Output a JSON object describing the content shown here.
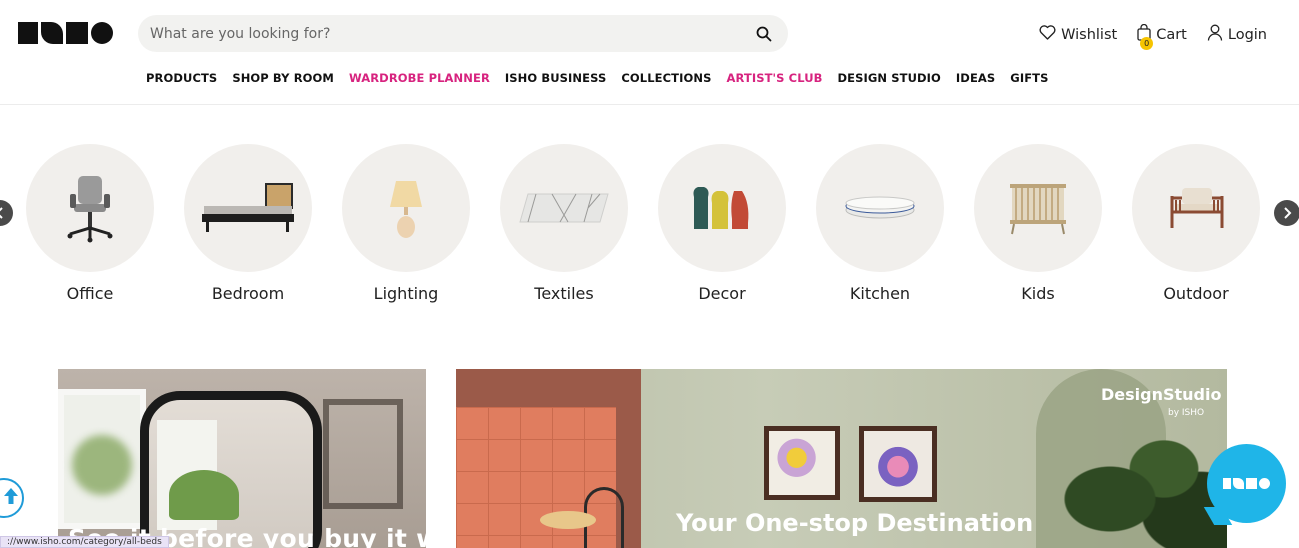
{
  "header": {
    "search": {
      "placeholder": "What are you looking for?"
    },
    "actions": {
      "wishlist": "Wishlist",
      "cart": "Cart",
      "cart_count": "0",
      "login": "Login"
    }
  },
  "nav": [
    {
      "label": "PRODUCTS",
      "highlight": false
    },
    {
      "label": "SHOP BY ROOM",
      "highlight": false
    },
    {
      "label": "WARDROBE PLANNER",
      "highlight": true
    },
    {
      "label": "ISHO BUSINESS",
      "highlight": false
    },
    {
      "label": "COLLECTIONS",
      "highlight": false
    },
    {
      "label": "ARTIST'S CLUB",
      "highlight": true
    },
    {
      "label": "DESIGN STUDIO",
      "highlight": false
    },
    {
      "label": "IDEAS",
      "highlight": false
    },
    {
      "label": "GIFTS",
      "highlight": false
    }
  ],
  "categories": [
    {
      "label": "Office",
      "icon": "office-chair-icon"
    },
    {
      "label": "Bedroom",
      "icon": "bed-icon"
    },
    {
      "label": "Lighting",
      "icon": "table-lamp-icon"
    },
    {
      "label": "Textiles",
      "icon": "rug-icon"
    },
    {
      "label": "Decor",
      "icon": "vases-icon"
    },
    {
      "label": "Kitchen",
      "icon": "plates-icon"
    },
    {
      "label": "Kids",
      "icon": "crib-icon"
    },
    {
      "label": "Outdoor",
      "icon": "armchair-icon"
    }
  ],
  "banners": {
    "ar": {
      "headline": "See it before you buy it with"
    },
    "design_studio": {
      "brand": "DesignStudio",
      "brand_sub": "by ISHO",
      "headline": "Your One-stop Destination"
    }
  },
  "status_url": "://www.isho.com/category/all-beds",
  "colors": {
    "accent_pink": "#d7237f",
    "chat_blue": "#1fb5e8",
    "cart_badge": "#f6c400"
  }
}
